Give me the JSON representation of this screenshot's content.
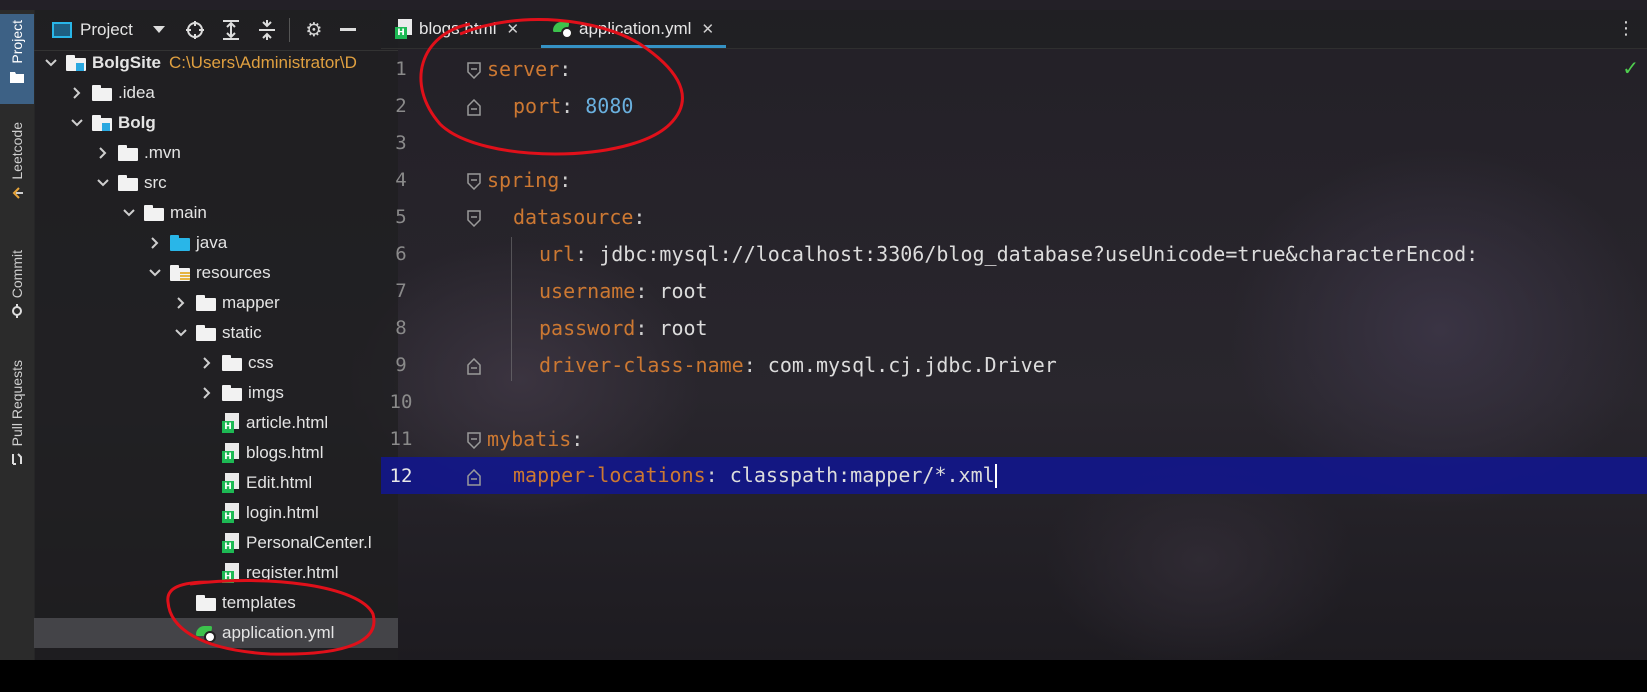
{
  "left_stripe": {
    "tabs": [
      {
        "label": "Project",
        "icon": "folder-icon"
      },
      {
        "label": "Leetcode",
        "icon": "leetcode-icon"
      },
      {
        "label": "Commit",
        "icon": "commit-icon"
      },
      {
        "label": "Pull Requests",
        "icon": "pull-request-icon"
      }
    ]
  },
  "project_panel": {
    "title": "Project",
    "toolbar_icons": [
      "chevron-down-icon",
      "locate-icon",
      "expand-all-icon",
      "collapse-all-icon",
      "gear-icon",
      "minimize-icon"
    ],
    "tree": [
      {
        "label": "BolgSite",
        "sub": "C:\\Users\\Administrator\\D",
        "icon": "module-folder",
        "depth": 0,
        "expanded": true,
        "bold": true
      },
      {
        "label": ".idea",
        "icon": "folder",
        "depth": 1,
        "expanded": false
      },
      {
        "label": "Bolg",
        "icon": "module-folder",
        "depth": 1,
        "expanded": true,
        "bold": true
      },
      {
        "label": ".mvn",
        "icon": "folder",
        "depth": 2,
        "expanded": false
      },
      {
        "label": "src",
        "icon": "folder",
        "depth": 2,
        "expanded": true
      },
      {
        "label": "main",
        "icon": "folder",
        "depth": 3,
        "expanded": true
      },
      {
        "label": "java",
        "icon": "source-folder",
        "depth": 4,
        "expanded": false
      },
      {
        "label": "resources",
        "icon": "resources-folder",
        "depth": 4,
        "expanded": true
      },
      {
        "label": "mapper",
        "icon": "folder",
        "depth": 5,
        "expanded": false
      },
      {
        "label": "static",
        "icon": "folder",
        "depth": 5,
        "expanded": true
      },
      {
        "label": "css",
        "icon": "folder",
        "depth": 6,
        "expanded": false
      },
      {
        "label": "imgs",
        "icon": "folder",
        "depth": 6,
        "expanded": false
      },
      {
        "label": "article.html",
        "icon": "html-file",
        "depth": 6
      },
      {
        "label": "blogs.html",
        "icon": "html-file",
        "depth": 6
      },
      {
        "label": "Edit.html",
        "icon": "html-file",
        "depth": 6
      },
      {
        "label": "login.html",
        "icon": "html-file",
        "depth": 6
      },
      {
        "label": "PersonalCenter.l",
        "icon": "html-file",
        "depth": 6
      },
      {
        "label": "register.html",
        "icon": "html-file",
        "depth": 6
      },
      {
        "label": "templates",
        "icon": "folder",
        "depth": 5
      },
      {
        "label": "application.yml",
        "icon": "yml-file",
        "depth": 5,
        "selected": true
      }
    ]
  },
  "editor": {
    "tabs": [
      {
        "label": "blogs.html",
        "icon": "html-file",
        "active": false
      },
      {
        "label": "application.yml",
        "icon": "yml-file",
        "active": true
      }
    ],
    "current_line": 12,
    "lines": [
      {
        "num": "1",
        "key": "server",
        "sep": ":",
        "value": "",
        "indent": 0
      },
      {
        "num": "2",
        "key": "port",
        "sep": ": ",
        "value": "8080",
        "indent": 1,
        "numeric": true
      },
      {
        "num": "3",
        "key": "",
        "sep": "",
        "value": "",
        "indent": 0
      },
      {
        "num": "4",
        "key": "spring",
        "sep": ":",
        "value": "",
        "indent": 0
      },
      {
        "num": "5",
        "key": "datasource",
        "sep": ":",
        "value": "",
        "indent": 1
      },
      {
        "num": "6",
        "key": "url",
        "sep": ": ",
        "value": "jdbc:mysql://localhost:3306/blog_database?useUnicode=true&characterEncod:",
        "indent": 2
      },
      {
        "num": "7",
        "key": "username",
        "sep": ": ",
        "value": "root",
        "indent": 2
      },
      {
        "num": "8",
        "key": "password",
        "sep": ": ",
        "value": "root",
        "indent": 2
      },
      {
        "num": "9",
        "key": "driver-class-name",
        "sep": ": ",
        "value": "com.mysql.cj.jdbc.Driver",
        "indent": 2
      },
      {
        "num": "10",
        "key": "",
        "sep": "",
        "value": "",
        "indent": 0
      },
      {
        "num": "11",
        "key": "mybatis",
        "sep": ":",
        "value": "",
        "indent": 0
      },
      {
        "num": "12",
        "key": "mapper-locations",
        "sep": ": ",
        "value": "classpath:mapper/*.xml",
        "indent": 1
      }
    ]
  },
  "colors": {
    "yaml_key": "#cc7832",
    "yaml_number": "#6ab0de",
    "current_line_bg": "#12168c",
    "annotation_red": "#e0101a",
    "active_tab_underline": "#3592c4"
  }
}
